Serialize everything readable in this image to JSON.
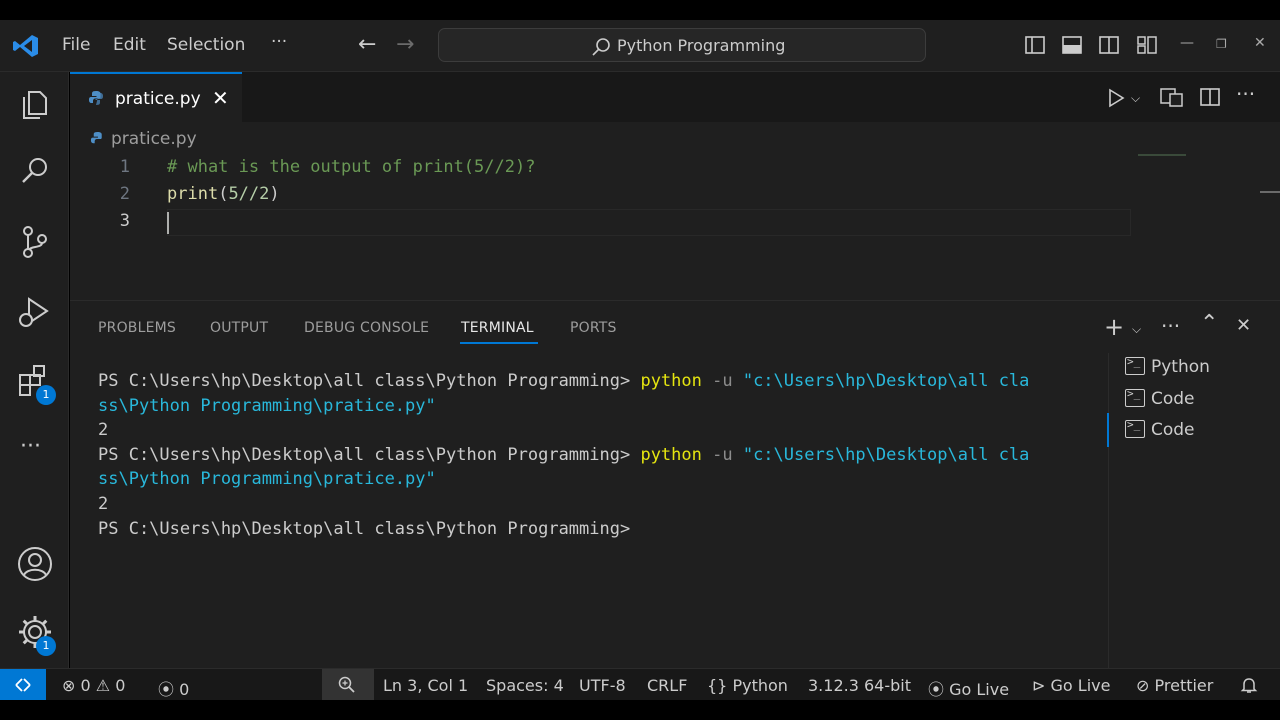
{
  "menu": {
    "file": "File",
    "edit": "Edit",
    "selection": "Selection",
    "more": "···"
  },
  "search": {
    "text": "Python Programming"
  },
  "window_controls": {
    "minimize": "—",
    "restore": "❐",
    "close": "✕"
  },
  "activity_badges": {
    "extensions": "1",
    "settings": "1"
  },
  "editor": {
    "tab_name": "pratice.py",
    "tab_close": "✕",
    "breadcrumb": "pratice.py",
    "lines": [
      {
        "num": "1",
        "text": "# what is the output of print(5//2)?"
      },
      {
        "num": "2",
        "fn": "print",
        "open": "(",
        "arg": "5//2",
        "close": ")"
      },
      {
        "num": "3",
        "text": ""
      }
    ]
  },
  "panel": {
    "tabs": [
      "PROBLEMS",
      "OUTPUT",
      "DEBUG CONSOLE",
      "TERMINAL",
      "PORTS"
    ],
    "active_tab": "TERMINAL",
    "terminal_lines": [
      {
        "prompt": "PS C:\\Users\\hp\\Desktop\\all class\\Python Programming> ",
        "cmd": "python",
        "flag": " -u ",
        "str": "\"c:\\Users\\hp\\Desktop\\all cla"
      },
      {
        "str": "ss\\Python Programming\\pratice.py\""
      },
      {
        "plain": "2"
      },
      {
        "prompt": "PS C:\\Users\\hp\\Desktop\\all class\\Python Programming> ",
        "cmd": "python",
        "flag": " -u ",
        "str": "\"c:\\Users\\hp\\Desktop\\all cla"
      },
      {
        "str": "ss\\Python Programming\\pratice.py\""
      },
      {
        "plain": "2"
      },
      {
        "prompt": "PS C:\\Users\\hp\\Desktop\\all class\\Python Programming>"
      }
    ],
    "terminals": [
      "Python",
      "Code",
      "Code"
    ]
  },
  "status": {
    "errors": "0",
    "warnings": "0",
    "ports": "0",
    "position": "Ln 3, Col 1",
    "spaces": "Spaces: 4",
    "encoding": "UTF-8",
    "eol": "CRLF",
    "language": "Python",
    "interpreter": "3.12.3 64-bit",
    "go_live_1": "Go Live",
    "go_live_2": "Go Live",
    "prettier": "Prettier"
  },
  "colors": {
    "accent": "#0078d4",
    "background": "#1f1f1f",
    "comment": "#6a9955",
    "function": "#dcdcaa",
    "terminal_cmd": "#e5e510",
    "terminal_string": "#29b8db"
  }
}
